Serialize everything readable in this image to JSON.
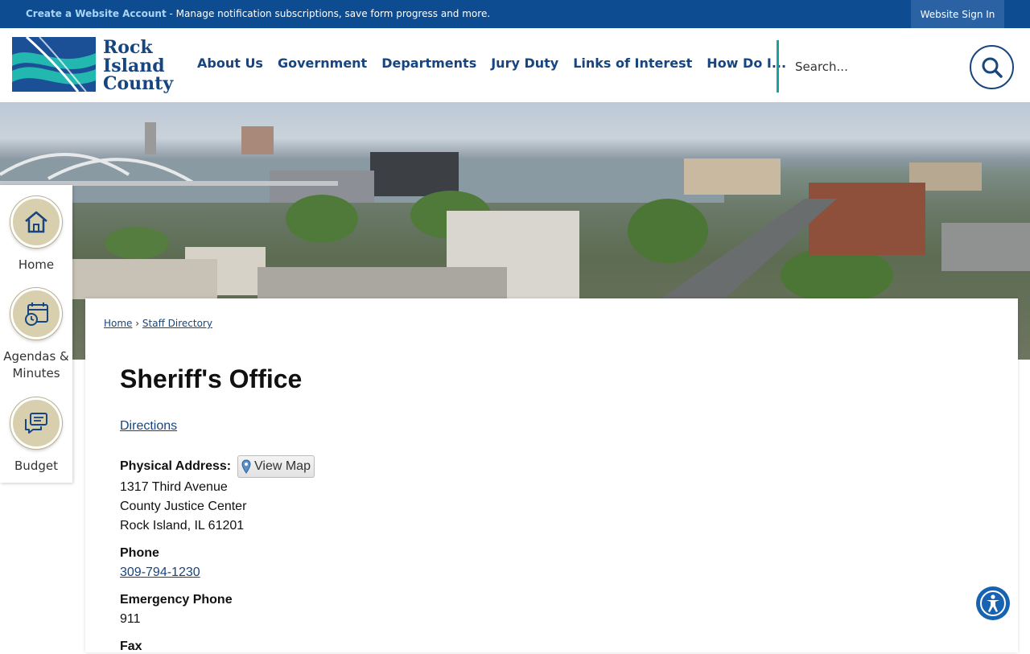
{
  "topbar": {
    "create_account": "Create a Website Account",
    "notice_text": " - Manage notification subscriptions, save form progress and more.",
    "signin": "Website Sign In"
  },
  "logo": {
    "line1": "Rock",
    "line2": "Island",
    "line3": "County"
  },
  "nav": {
    "items": [
      "About Us",
      "Government",
      "Departments",
      "Jury Duty",
      "Links of Interest",
      "How Do I..."
    ]
  },
  "search": {
    "placeholder": "Search..."
  },
  "quick_links": [
    {
      "label": "Home",
      "icon": "home-icon"
    },
    {
      "label": "Agendas &",
      "label2": "Minutes",
      "icon": "calendar-clock-icon"
    },
    {
      "label": "Budget",
      "icon": "chat-bubbles-icon"
    }
  ],
  "breadcrumb": {
    "home": "Home",
    "sep": "›",
    "current": "Staff Directory"
  },
  "page": {
    "title": "Sheriff's Office",
    "directions": "Directions",
    "physical_address_label": "Physical Address:",
    "view_map": "View Map",
    "address_line1": "1317 Third Avenue",
    "address_line2": "County Justice Center",
    "address_line3": "Rock Island, IL 61201",
    "phone_label": "Phone",
    "phone": "309-794-1230",
    "emergency_label": "Emergency Phone",
    "emergency": "911",
    "next_label": "Fax"
  },
  "colors": {
    "primary": "#0e4c92",
    "nav_text": "#17457f",
    "accent": "#1aa39b",
    "quick_circle": "#d8cfae"
  }
}
